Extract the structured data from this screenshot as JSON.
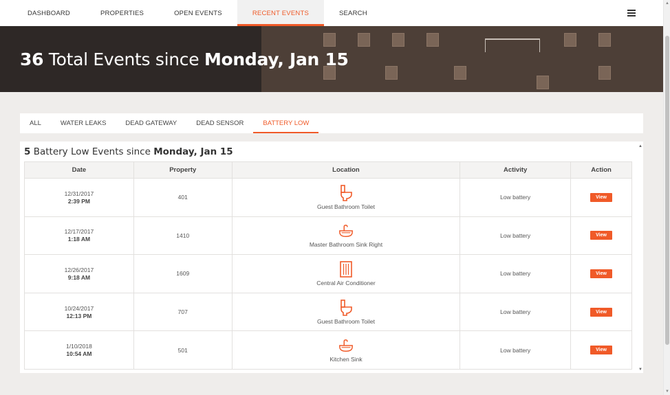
{
  "nav": {
    "items": [
      {
        "label": "DASHBOARD",
        "active": false
      },
      {
        "label": "PROPERTIES",
        "active": false
      },
      {
        "label": "OPEN EVENTS",
        "active": false
      },
      {
        "label": "RECENT EVENTS",
        "active": true
      },
      {
        "label": "SEARCH",
        "active": false
      }
    ],
    "menu_icon": "hamburger-icon"
  },
  "hero": {
    "count": "36",
    "text": " Total Events since ",
    "date": "Monday, Jan 15"
  },
  "filters": {
    "tabs": [
      {
        "label": "ALL",
        "active": false
      },
      {
        "label": "WATER LEAKS",
        "active": false
      },
      {
        "label": "DEAD GATEWAY",
        "active": false
      },
      {
        "label": "DEAD SENSOR",
        "active": false
      },
      {
        "label": "BATTERY LOW",
        "active": true
      }
    ]
  },
  "panel": {
    "count": "5",
    "text": " Battery Low Events since ",
    "date": "Monday, Jan 15"
  },
  "table": {
    "headers": [
      "Date",
      "Property",
      "Location",
      "Activity",
      "Action"
    ],
    "rows": [
      {
        "date": "12/31/2017",
        "time": "2:39 PM",
        "property": "401",
        "location": "Guest Bathroom Toilet",
        "icon": "toilet-icon",
        "activity": "Low battery",
        "action": "View"
      },
      {
        "date": "12/17/2017",
        "time": "1:18 AM",
        "property": "1410",
        "location": "Master Bathroom Sink Right",
        "icon": "sink-icon",
        "activity": "Low battery",
        "action": "View"
      },
      {
        "date": "12/26/2017",
        "time": "9:18 AM",
        "property": "1609",
        "location": "Central Air Conditioner",
        "icon": "air-conditioner-icon",
        "activity": "Low battery",
        "action": "View"
      },
      {
        "date": "10/24/2017",
        "time": "12:13 PM",
        "property": "707",
        "location": "Guest Bathroom Toilet",
        "icon": "toilet-icon",
        "activity": "Low battery",
        "action": "View"
      },
      {
        "date": "1/10/2018",
        "time": "10:54 AM",
        "property": "501",
        "location": "Kitchen Sink",
        "icon": "sink-icon",
        "activity": "Low battery",
        "action": "View"
      }
    ]
  },
  "colors": {
    "accent": "#f05a28",
    "page_bg": "#efedeb"
  }
}
